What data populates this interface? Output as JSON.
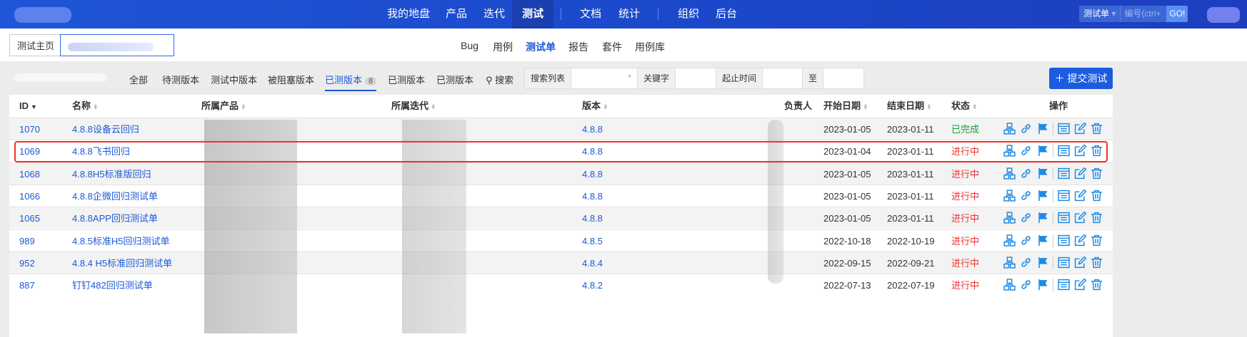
{
  "topnav": {
    "items": [
      "我的地盘",
      "产品",
      "迭代",
      "测试",
      "文档",
      "统计",
      "组织",
      "后台"
    ],
    "active": "测试",
    "quick_search": {
      "type": "测试单",
      "placeholder": "编号(ctrl+",
      "go": "GO!"
    }
  },
  "breadcrumb": {
    "home": "测试主页"
  },
  "subnav": {
    "items": [
      "Bug",
      "用例",
      "测试单",
      "报告",
      "套件",
      "用例库"
    ],
    "active": "测试单"
  },
  "filters": {
    "tabs": [
      "全部",
      "待测版本",
      "测试中版本",
      "被阻塞版本",
      "已测版本",
      "已测版本",
      "已测版本"
    ],
    "active_index": 4,
    "active_count": "8",
    "search": "搜索",
    "search_list_label": "搜索列表",
    "keyword_label": "关键字",
    "date_label": "起止时间",
    "to_label": "至"
  },
  "submit_button": "提交测试",
  "table": {
    "headers": [
      "ID",
      "名称",
      "所属产品",
      "所属迭代",
      "版本",
      "负责人",
      "开始日期",
      "结束日期",
      "状态",
      "操作"
    ],
    "rows": [
      {
        "id": "1070",
        "name": "4.8.8设备云回归",
        "version": "4.8.8",
        "start": "2023-01-05",
        "end": "2023-01-11",
        "status": "已完成"
      },
      {
        "id": "1069",
        "name": "4.8.8飞书回归",
        "version": "4.8.8",
        "start": "2023-01-04",
        "end": "2023-01-11",
        "status": "进行中"
      },
      {
        "id": "1068",
        "name": "4.8.8H5标准版回归",
        "version": "4.8.8",
        "start": "2023-01-05",
        "end": "2023-01-11",
        "status": "进行中"
      },
      {
        "id": "1066",
        "name": "4.8.8企微回归测试单",
        "version": "4.8.8",
        "start": "2023-01-05",
        "end": "2023-01-11",
        "status": "进行中"
      },
      {
        "id": "1065",
        "name": "4.8.8APP回归测试单",
        "version": "4.8.8",
        "start": "2023-01-05",
        "end": "2023-01-11",
        "status": "进行中"
      },
      {
        "id": "989",
        "name": "4.8.5标准H5回归测试单",
        "version": "4.8.5",
        "start": "2022-10-18",
        "end": "2022-10-19",
        "status": "进行中"
      },
      {
        "id": "952",
        "name": "4.8.4 H5标准回归测试单",
        "version": "4.8.4",
        "start": "2022-09-15",
        "end": "2022-09-21",
        "status": "进行中"
      },
      {
        "id": "887",
        "name": "钉钉482回归测试单",
        "version": "4.8.2",
        "start": "2022-07-13",
        "end": "2022-07-19",
        "status": "进行中"
      }
    ]
  }
}
